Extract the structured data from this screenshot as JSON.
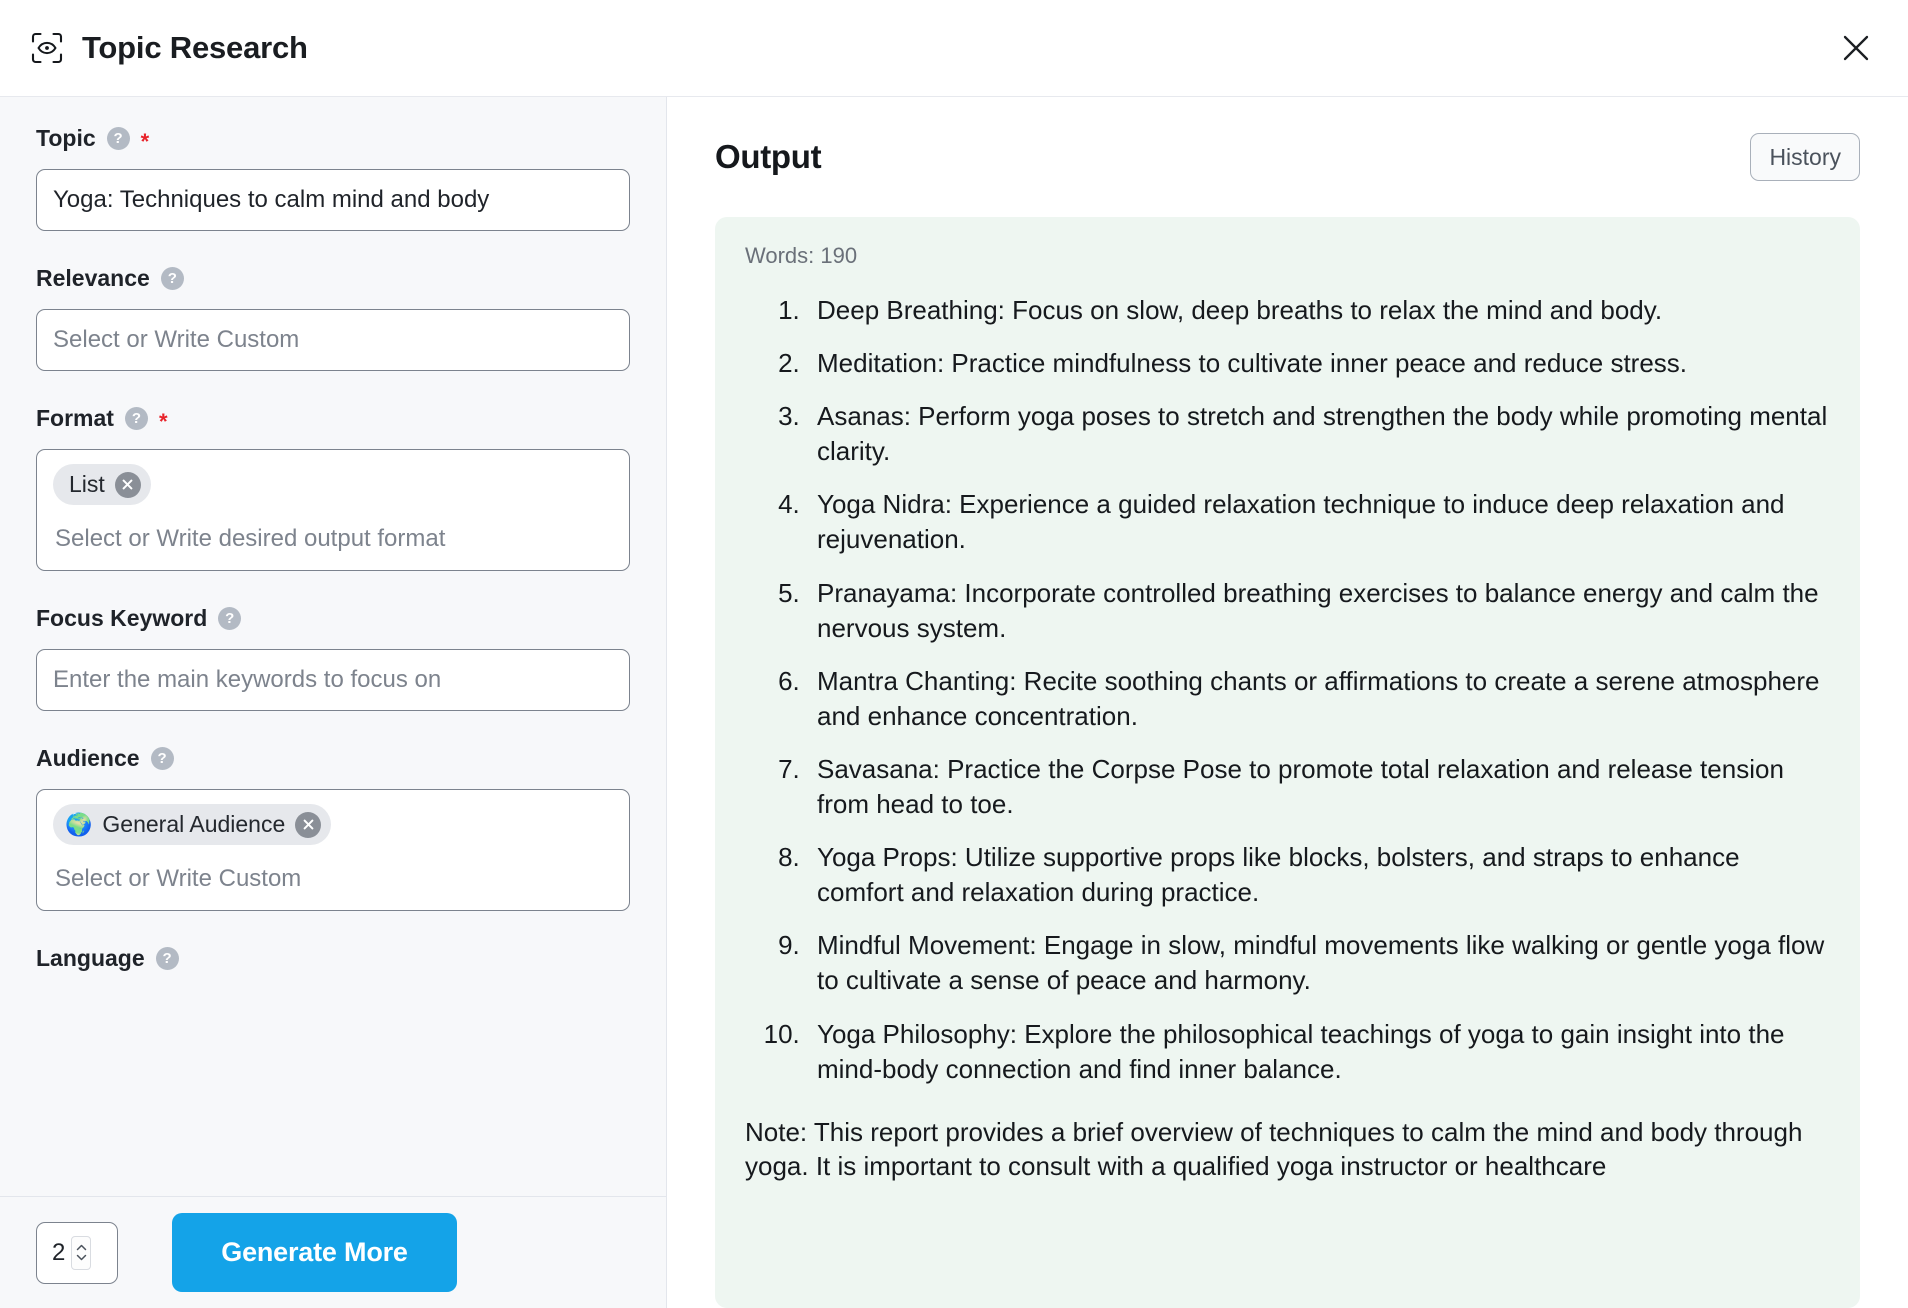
{
  "header": {
    "icon": "scan-eye-icon",
    "title": "Topic Research",
    "close_label": "close-icon"
  },
  "sidebar": {
    "fields": [
      {
        "label": "Topic",
        "required": true,
        "type": "text",
        "value": "Yoga: Techniques to calm mind and body",
        "placeholder": ""
      },
      {
        "label": "Relevance",
        "required": false,
        "type": "text",
        "value": "",
        "placeholder": "Select or Write Custom"
      },
      {
        "label": "Format",
        "required": true,
        "type": "tags",
        "chips": [
          {
            "emoji": "",
            "label": "List"
          }
        ],
        "placeholder": "Select or Write desired output format"
      },
      {
        "label": "Focus Keyword",
        "required": false,
        "type": "text",
        "value": "",
        "placeholder": "Enter the main keywords to focus on"
      },
      {
        "label": "Audience",
        "required": false,
        "type": "tags",
        "chips": [
          {
            "emoji": "🌍",
            "label": "General Audience"
          }
        ],
        "placeholder": "Select or Write Custom"
      },
      {
        "label": "Language",
        "required": false,
        "type": "none"
      }
    ],
    "footer": {
      "count_value": "2",
      "generate_label": "Generate More"
    }
  },
  "output": {
    "title": "Output",
    "history_label": "History",
    "words_label": "Words: 190",
    "items": [
      "Deep Breathing: Focus on slow, deep breaths to relax the mind and body.",
      "Meditation: Practice mindfulness to cultivate inner peace and reduce stress.",
      "Asanas: Perform yoga poses to stretch and strengthen the body while promoting mental clarity.",
      "Yoga Nidra: Experience a guided relaxation technique to induce deep relaxation and rejuvenation.",
      "Pranayama: Incorporate controlled breathing exercises to balance energy and calm the nervous system.",
      "Mantra Chanting: Recite soothing chants or affirmations to create a serene atmosphere and enhance concentration.",
      "Savasana: Practice the Corpse Pose to promote total relaxation and release tension from head to toe.",
      "Yoga Props: Utilize supportive props like blocks, bolsters, and straps to enhance comfort and relaxation during practice.",
      "Mindful Movement: Engage in slow, mindful movements like walking or gentle yoga flow to cultivate a sense of peace and harmony.",
      "Yoga Philosophy: Explore the philosophical teachings of yoga to gain insight into the mind-body connection and find inner balance."
    ],
    "note": "Note: This report provides a brief overview of techniques to calm the mind and body through yoga. It is important to consult with a qualified yoga instructor or healthcare"
  },
  "colors": {
    "accent": "#14a3e8",
    "required_star": "#e8232a",
    "output_bg": "#eef6f1",
    "sidebar_bg": "#f7f8fa"
  }
}
